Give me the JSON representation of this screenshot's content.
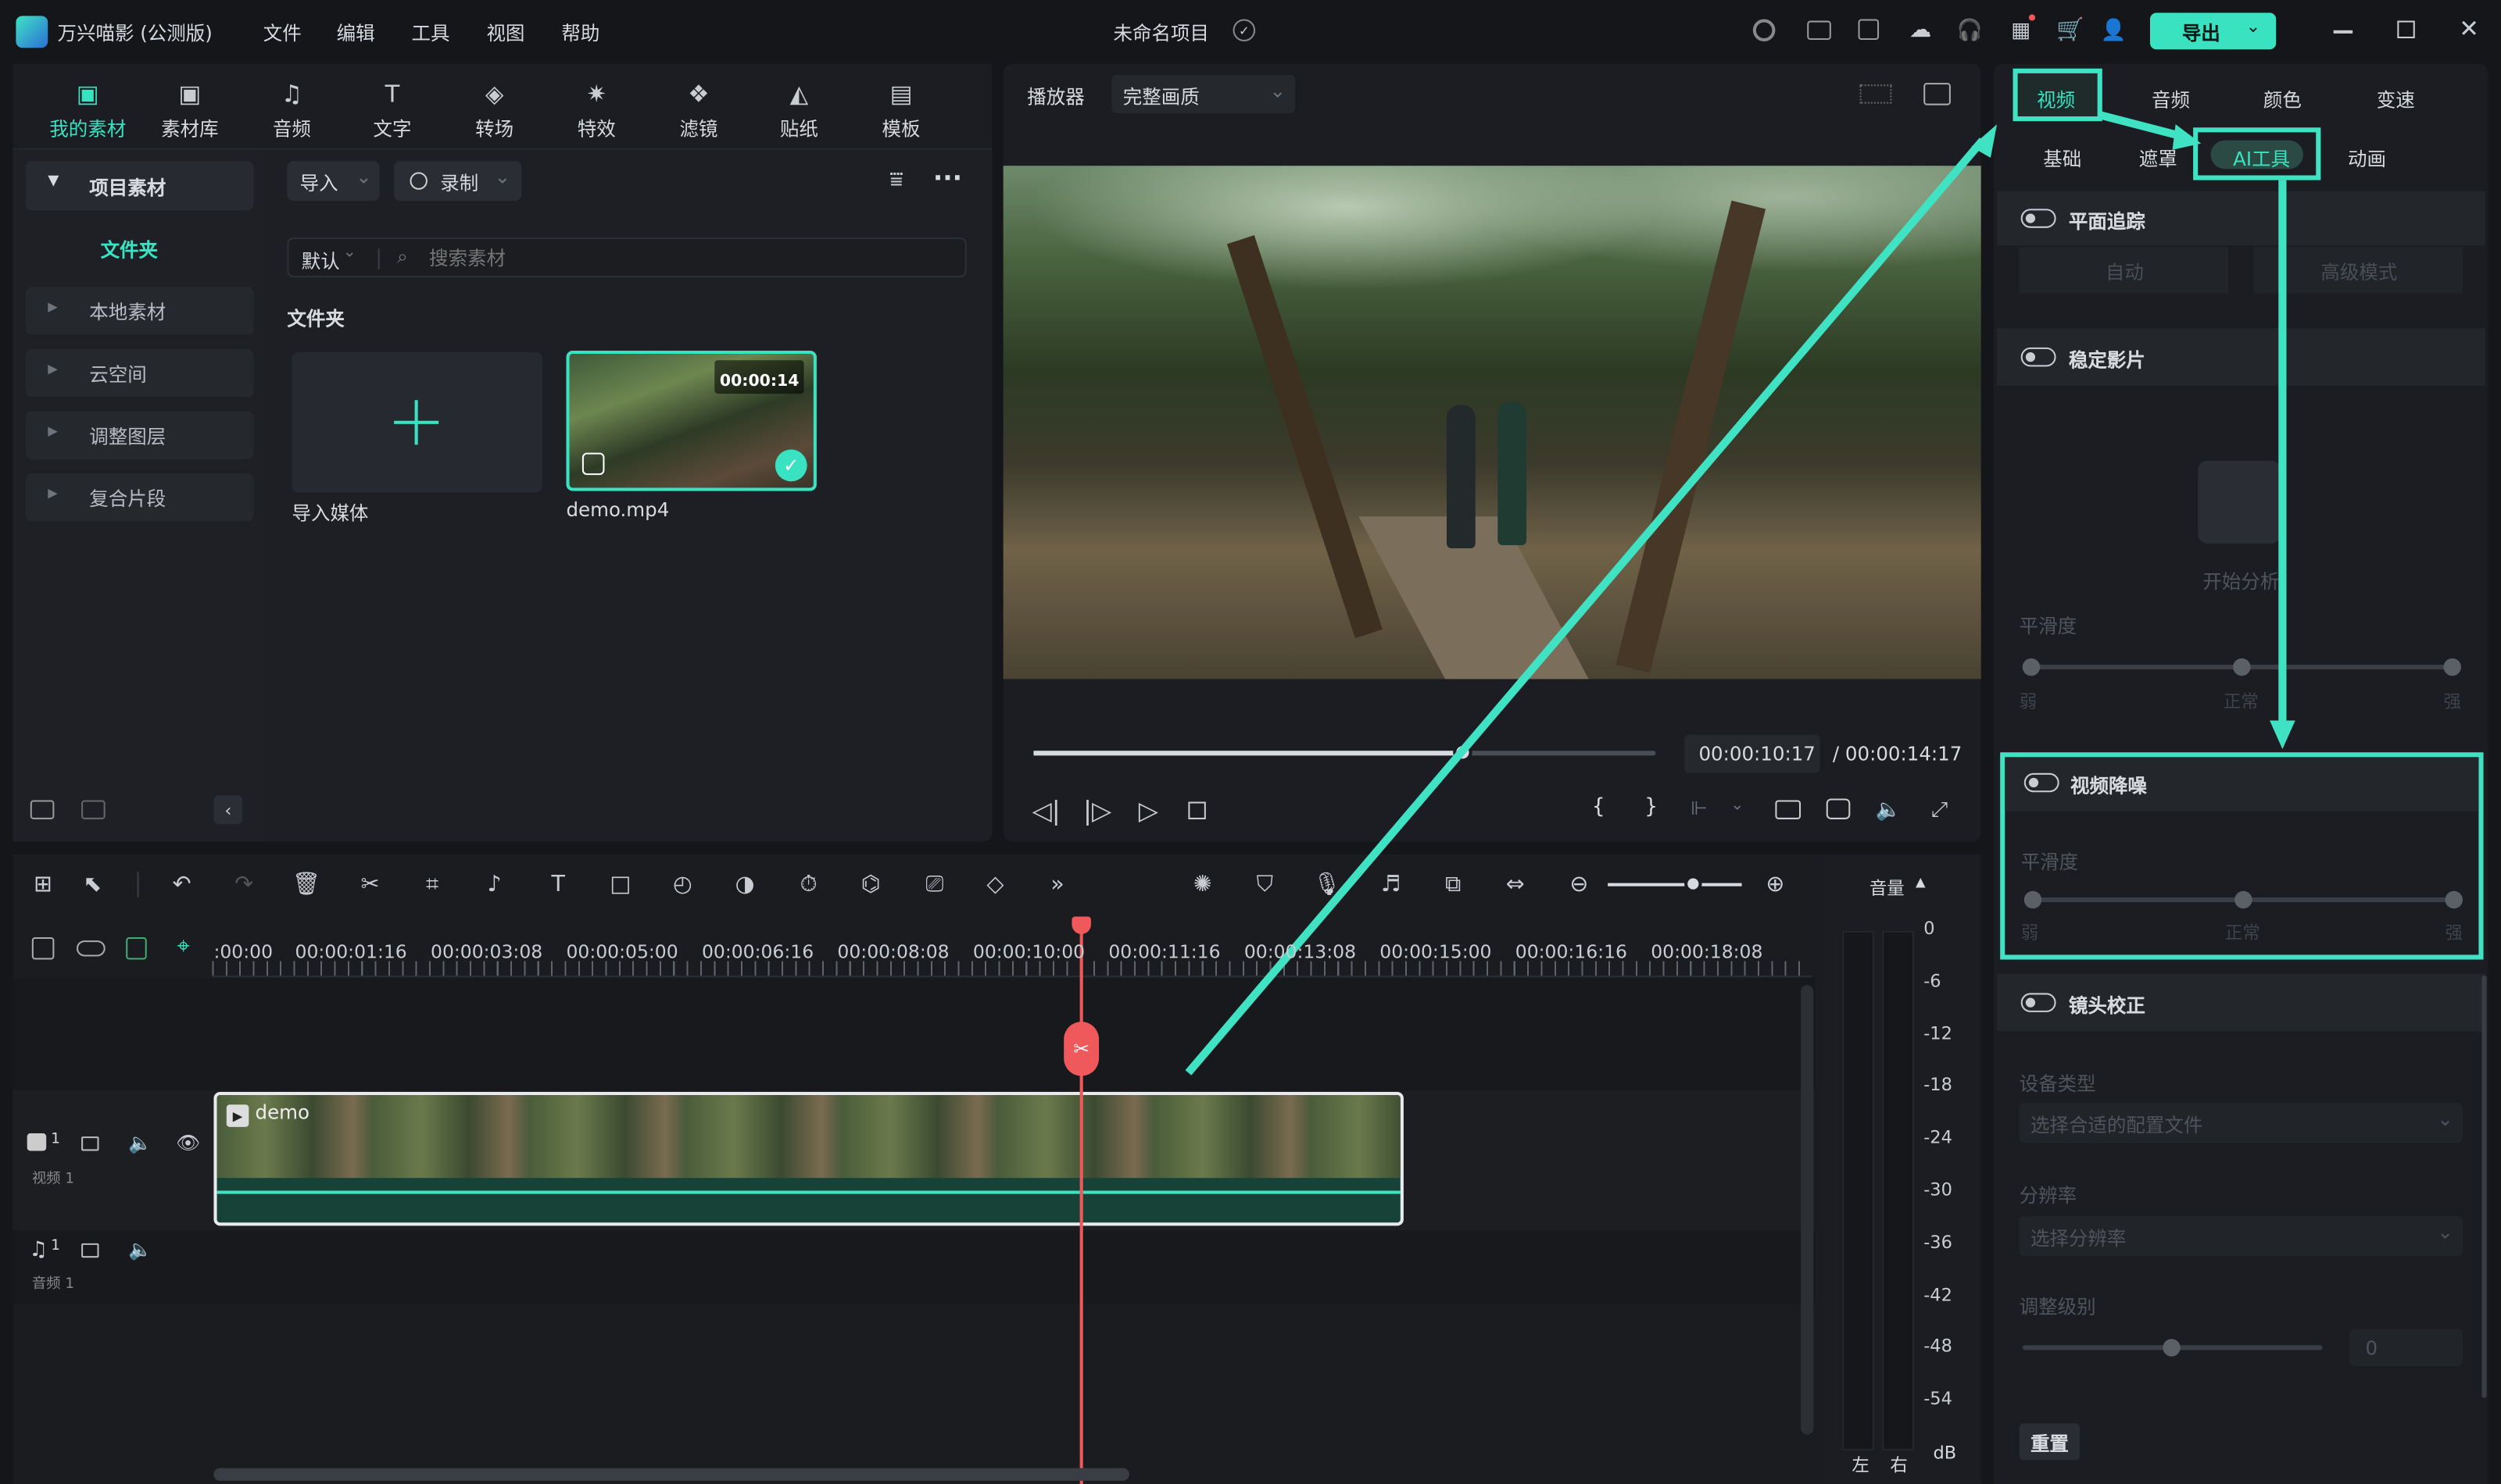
{
  "app": {
    "name": "万兴喵影 (公测版)",
    "project": "未命名项目",
    "export": "导出"
  },
  "menu": [
    "文件",
    "编辑",
    "工具",
    "视图",
    "帮助"
  ],
  "media_tabs": [
    "我的素材",
    "素材库",
    "音频",
    "文字",
    "转场",
    "特效",
    "滤镜",
    "贴纸",
    "模板"
  ],
  "sidebar": {
    "items": [
      "项目素材",
      "文件夹",
      "本地素材",
      "云空间",
      "调整图层",
      "复合片段"
    ]
  },
  "media": {
    "import": "导入",
    "record": "录制",
    "sort": "默认",
    "search_placeholder": "搜索素材",
    "folder": "文件夹",
    "import_media": "导入媒体",
    "clip_name": "demo.mp4",
    "clip_duration": "00:00:14"
  },
  "player": {
    "label": "播放器",
    "quality": "完整画质",
    "current": "00:00:10:17",
    "total": "/ 00:00:14:17",
    "progress": 0.69
  },
  "timeline": {
    "ticks": [
      ":00:00",
      "00:00:01:16",
      "00:00:03:08",
      "00:00:05:00",
      "00:00:06:16",
      "00:00:08:08",
      "00:00:10:00",
      "00:00:11:16",
      "00:00:13:08",
      "00:00:15:00",
      "00:00:16:16",
      "00:00:18:08"
    ],
    "clip_label": "demo",
    "video_track": "视频 1",
    "audio_track": "音频 1",
    "track_v_num": "1",
    "track_a_num": "1"
  },
  "volume": {
    "label": "音量",
    "scale": [
      "0",
      "-6",
      "-12",
      "-18",
      "-24",
      "-30",
      "-36",
      "-42",
      "-48",
      "-54"
    ],
    "unit": "dB",
    "left": "左",
    "right": "右"
  },
  "props": {
    "tabs": [
      "视频",
      "音频",
      "颜色",
      "变速"
    ],
    "subtabs": [
      "基础",
      "遮罩",
      "AI工具",
      "动画"
    ],
    "plane_track": "平面追踪",
    "auto": "自动",
    "advanced": "高级模式",
    "stabilize": "稳定影片",
    "analyze": "开始分析",
    "smooth": "平滑度",
    "weak": "弱",
    "normal": "正常",
    "strong": "强",
    "denoise": "视频降噪",
    "denoise_smooth": "平滑度",
    "lens": "镜头校正",
    "device": "设备类型",
    "device_ph": "选择合适的配置文件",
    "res": "分辨率",
    "res_ph": "选择分辨率",
    "level": "调整级别",
    "level_val": "0",
    "reset": "重置"
  },
  "colors": {
    "accent": "#39e2c1",
    "playhead": "#f0595b",
    "highlight": "#3fe3c3"
  }
}
